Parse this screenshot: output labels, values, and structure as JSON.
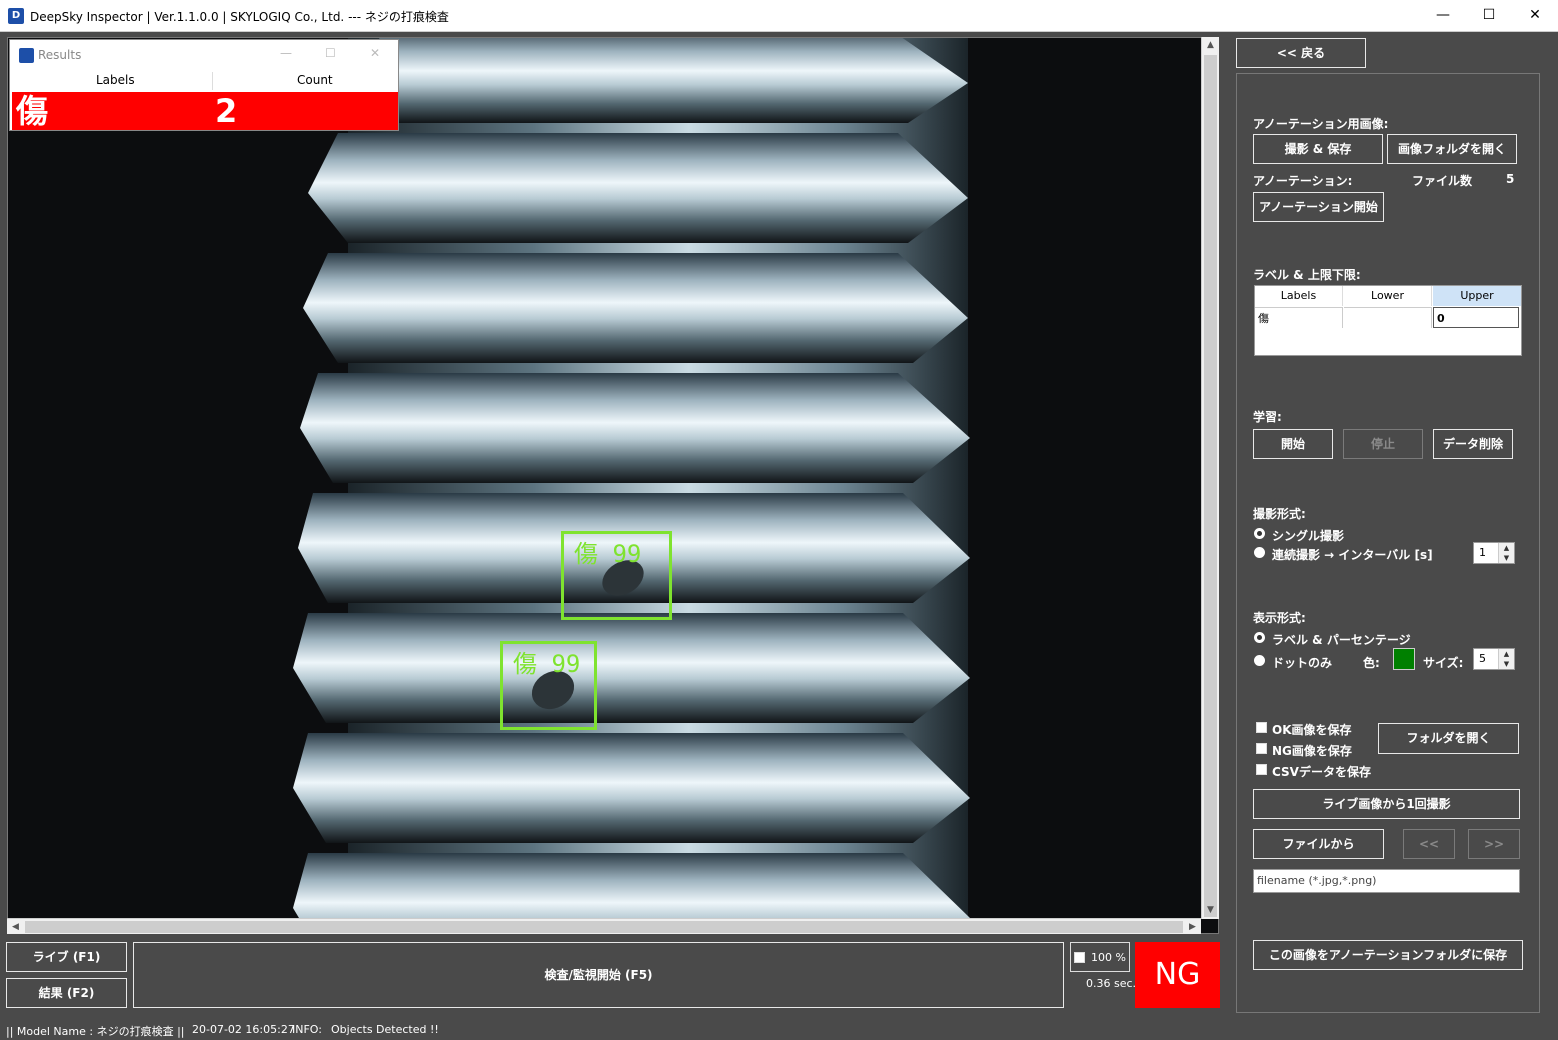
{
  "window": {
    "title": "DeepSky Inspector | Ver.1.1.0.0 | SKYLOGIQ Co., Ltd. --- ネジの打痕検査",
    "minimize": "—",
    "maximize": "☐",
    "close": "✕"
  },
  "results_window": {
    "title": "Results",
    "col_labels": "Labels",
    "col_count": "Count",
    "row_label": "傷",
    "row_count": "2"
  },
  "detections": [
    {
      "label": "傷 99"
    },
    {
      "label": "傷 99"
    }
  ],
  "colors": {
    "accent_red": "#ff0000",
    "bbox_green": "#7fe32f",
    "background": "#4a4a4a",
    "dot_color": "#008000"
  },
  "bottom": {
    "live_button": "ライブ (F1)",
    "result_button": "結果 (F2)",
    "inspect_button": "検査/監視開始 (F5)",
    "zoom_value": "100 %",
    "elapsed": "0.36 sec.",
    "judgement": "NG"
  },
  "side": {
    "back_button": "<< 戻る",
    "annotation_image_label": "アノーテーション用画像:",
    "capture_save_button": "撮影 & 保存",
    "open_image_folder_button": "画像フォルダを開く",
    "annotation_label": "アノーテーション:",
    "file_count_label": "ファイル数",
    "file_count_value": "5",
    "annotation_start_button": "アノーテーション開始",
    "label_limits_label": "ラベル & 上限下限:",
    "grid_headers": [
      "Labels",
      "Lower",
      "Upper"
    ],
    "grid_row": [
      "傷",
      "",
      "0"
    ],
    "learning_label": "学習:",
    "start_button": "開始",
    "stop_button": "停止",
    "delete_data_button": "データ削除",
    "capture_mode_label": "撮影形式:",
    "single_capture": "シングル撮影",
    "continuous_capture": "連続撮影 → インターバル [s]",
    "interval_value": "1",
    "display_mode_label": "表示形式:",
    "label_percentage": "ラベル & パーセンテージ",
    "dots_only": "ドットのみ",
    "color_label": "色:",
    "size_label": "サイズ:",
    "size_value": "5",
    "save_ok": "OK画像を保存",
    "save_ng": "NG画像を保存",
    "save_csv": "CSVデータを保存",
    "open_folder_button": "フォルダを開く",
    "capture_once_button": "ライブ画像から1回撮影",
    "from_file_button": "ファイルから",
    "prev_button": "<<",
    "next_button": ">>",
    "filename_placeholder": "filename (*.jpg,*.png)",
    "save_to_annotation_button": "この画像をアノーテーションフォルダに保存"
  },
  "status": {
    "model": "|| Model Name : ネジの打痕検査 ||",
    "datetime": "20-07-02 16:05:27",
    "info_label": "INFO:",
    "info_text": "Objects Detected !!"
  }
}
